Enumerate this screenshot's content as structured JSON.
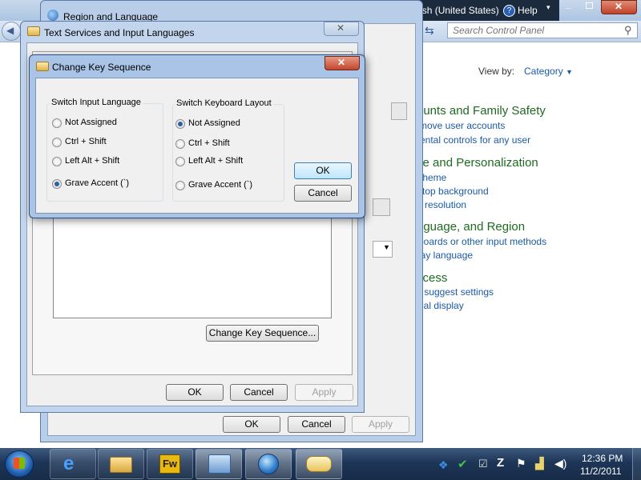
{
  "control_panel": {
    "search_placeholder": "Search Control Panel",
    "view_by_label": "View by:",
    "view_by_value": "Category",
    "categories": [
      {
        "title": "ounts and Family Safety",
        "links": [
          "move user accounts",
          "rental controls for any user"
        ]
      },
      {
        "title": "ce and Personalization",
        "links": [
          "theme",
          "ktop background",
          "n resolution"
        ]
      },
      {
        "title": "nguage, and Region",
        "links": [
          "boards or other input methods",
          "lay language"
        ]
      },
      {
        "title": "ccess",
        "links": [
          "s suggest settings",
          "ual display"
        ]
      }
    ]
  },
  "language_bar": {
    "language": "EN English (United States)",
    "help": "Help"
  },
  "region_window": {
    "title": "Region and Language",
    "buttons": {
      "ok": "OK",
      "cancel": "Cancel",
      "apply": "Apply"
    }
  },
  "text_services_window": {
    "title": "Text Services and Input Languages",
    "change_key_sequence_button": "Change Key Sequence...",
    "buttons": {
      "ok": "OK",
      "cancel": "Cancel",
      "apply": "Apply"
    }
  },
  "dialog": {
    "title": "Change Key Sequence",
    "switch_input_language": {
      "title": "Switch Input Language",
      "options": [
        "Not Assigned",
        "Ctrl + Shift",
        "Left Alt + Shift",
        "Grave Accent (`)"
      ],
      "selected": "Grave Accent (`)"
    },
    "switch_keyboard_layout": {
      "title": "Switch Keyboard Layout",
      "options": [
        "Not Assigned",
        "Ctrl + Shift",
        "Left Alt + Shift",
        "Grave Accent (`)"
      ],
      "selected": "Not Assigned"
    },
    "ok": "OK",
    "cancel": "Cancel",
    "close_glyph": "✕"
  },
  "taskbar": {
    "start_icon": "windows-orb-icon",
    "apps": [
      "internet-explorer-icon",
      "explorer-icon",
      "fireworks-icon",
      "control-panel-icon",
      "world-clock-icon",
      "keyboard-icon"
    ],
    "fireworks_label": "Fw",
    "time": "12:36 PM",
    "date": "11/2/2011"
  }
}
